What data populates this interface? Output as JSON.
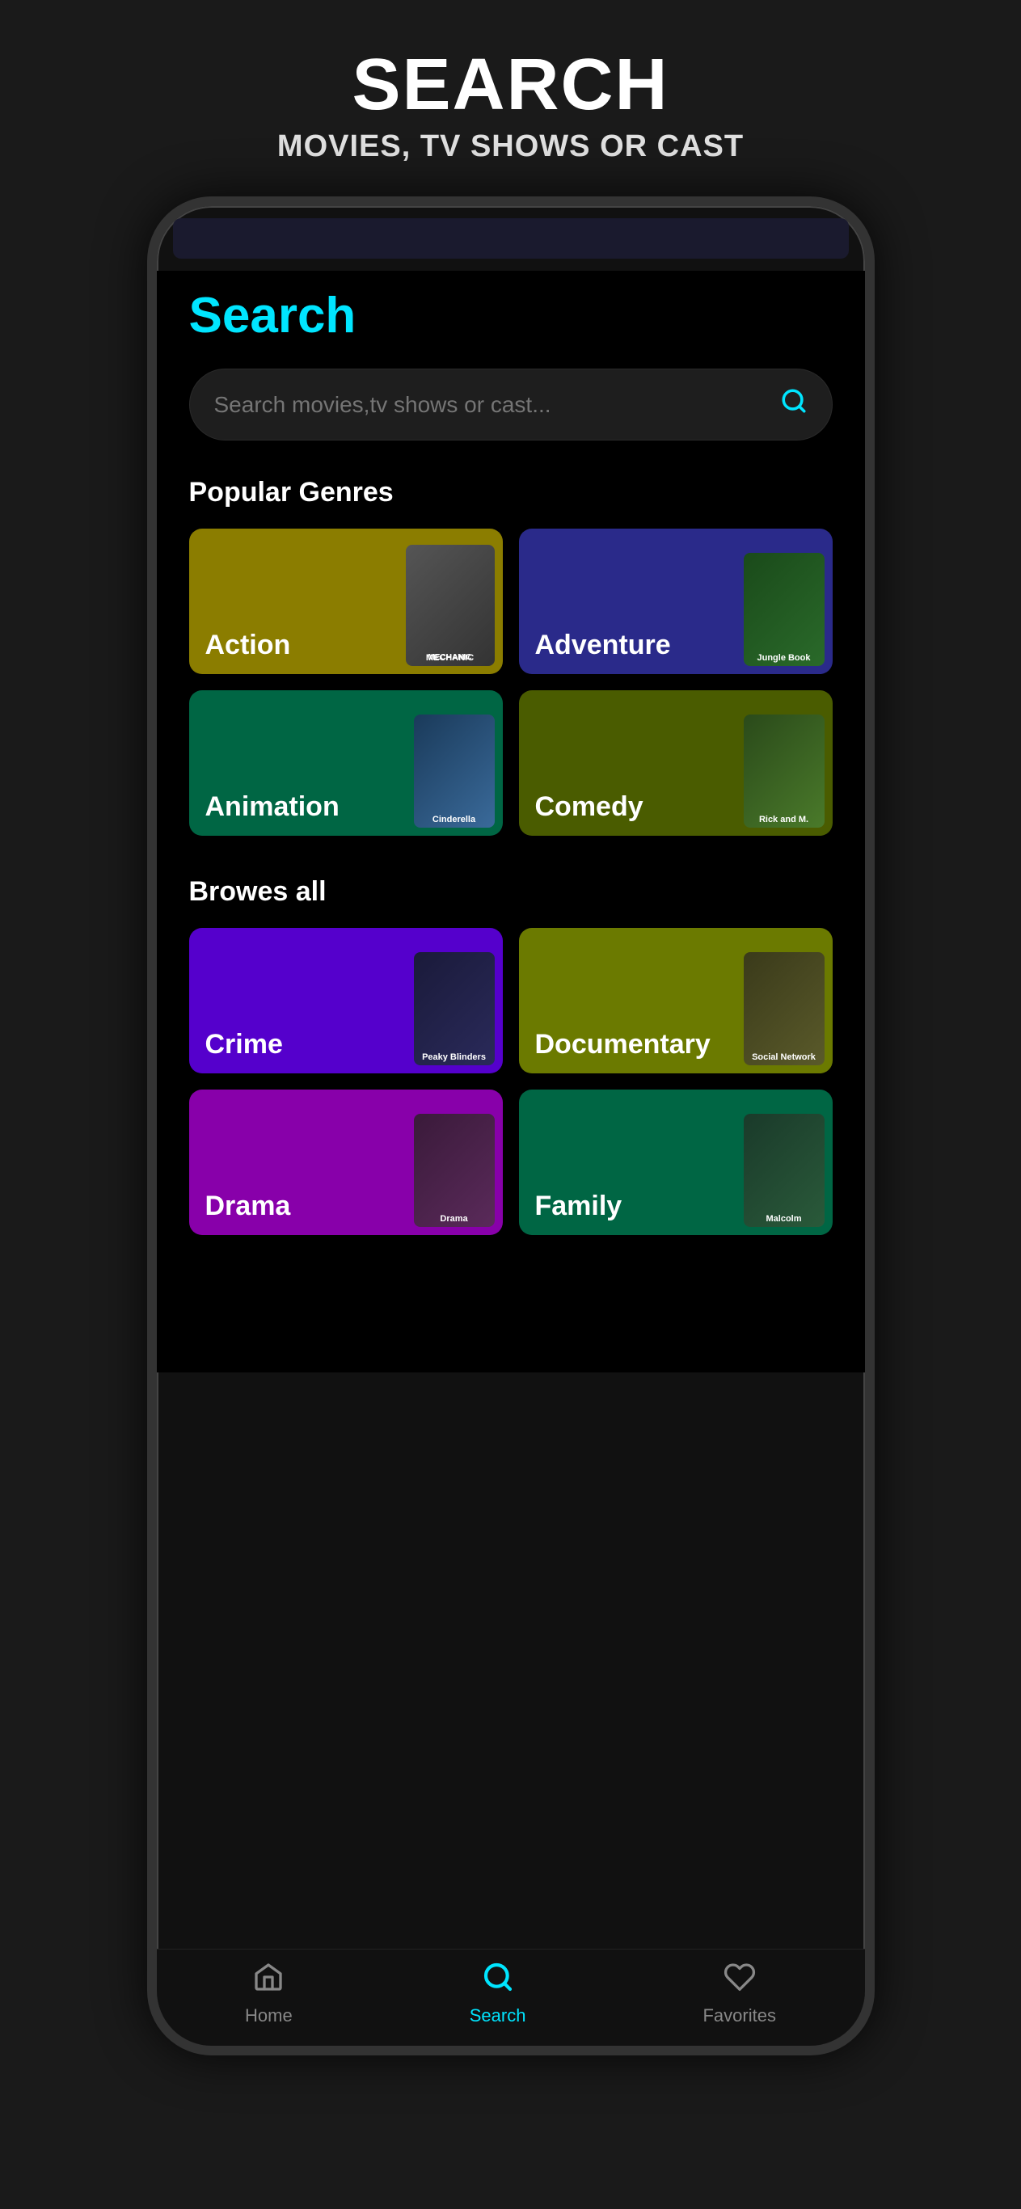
{
  "page": {
    "background_color": "#1a1a1a"
  },
  "header": {
    "title": "SEARCH",
    "subtitle": "MOVIES, TV SHOWS OR CAST"
  },
  "phone": {
    "search_page_title": "Search",
    "search_placeholder": "Search movies,tv shows or cast...",
    "popular_genres_title": "Popular Genres",
    "browse_all_title": "Browes all",
    "genres_popular": [
      {
        "label": "Action",
        "color": "#8B7D00",
        "css_class": "genre-card-action",
        "poster_css": "poster-action",
        "poster_text": "MECHANIC"
      },
      {
        "label": "Adventure",
        "color": "#2a2a8a",
        "css_class": "genre-card-adventure",
        "poster_css": "poster-jungle",
        "poster_text": "Jungle Book"
      },
      {
        "label": "Animation",
        "color": "#006644",
        "css_class": "genre-card-animation",
        "poster_css": "poster-cinderella",
        "poster_text": "Cinderella"
      },
      {
        "label": "Comedy",
        "color": "#4a5c00",
        "css_class": "genre-card-comedy",
        "poster_css": "poster-rick",
        "poster_text": "Rick and M."
      }
    ],
    "genres_all": [
      {
        "label": "Crime",
        "color": "#5500cc",
        "css_class": "genre-card-crime",
        "poster_css": "poster-peaky",
        "poster_text": "Peaky Blinders"
      },
      {
        "label": "Documentary",
        "color": "#6b7a00",
        "css_class": "genre-card-documentary",
        "poster_css": "poster-social",
        "poster_text": "Social Network"
      },
      {
        "label": "Drama",
        "color": "#8800aa",
        "css_class": "genre-card-drama",
        "poster_css": "poster-drama",
        "poster_text": "Drama"
      },
      {
        "label": "Family",
        "color": "#006644",
        "css_class": "genre-card-family",
        "poster_css": "poster-malcolm",
        "poster_text": "Malcolm"
      }
    ],
    "nav_items": [
      {
        "id": "home",
        "label": "Home",
        "active": false
      },
      {
        "id": "search",
        "label": "Search",
        "active": true
      },
      {
        "id": "favorites",
        "label": "Favorites",
        "active": false
      }
    ]
  }
}
